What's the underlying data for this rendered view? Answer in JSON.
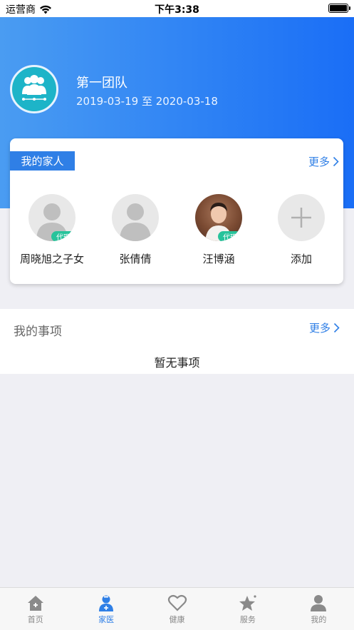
{
  "status_bar": {
    "carrier": "运营商",
    "time": "下午3:38"
  },
  "team": {
    "name": "第一团队",
    "dates": "2019-03-19 至 2020-03-18"
  },
  "family": {
    "title": "我的家人",
    "more": "更多",
    "members": [
      {
        "name": "周晓旭之子女",
        "badge": "代理",
        "avatar": "default-person-icon"
      },
      {
        "name": "张倩倩",
        "badge": "",
        "avatar": "default-person-icon"
      },
      {
        "name": "汪博涵",
        "badge": "代理",
        "avatar": "photo"
      },
      {
        "name": "添加",
        "badge": "",
        "avatar": "plus-icon"
      }
    ]
  },
  "affairs": {
    "title": "我的事项",
    "more": "更多",
    "empty": "暂无事项"
  },
  "tabbar": {
    "tabs": [
      {
        "label": "首页",
        "icon": "home-icon",
        "active": false
      },
      {
        "label": "家医",
        "icon": "doctor-icon",
        "active": true
      },
      {
        "label": "健康",
        "icon": "heart-icon",
        "active": false
      },
      {
        "label": "服务",
        "icon": "star-icon",
        "active": false
      },
      {
        "label": "我的",
        "icon": "profile-icon",
        "active": false
      }
    ]
  },
  "colors": {
    "accent": "#2f7fe6",
    "badge": "#27c39b",
    "team_avatar": "#1db4c8"
  }
}
